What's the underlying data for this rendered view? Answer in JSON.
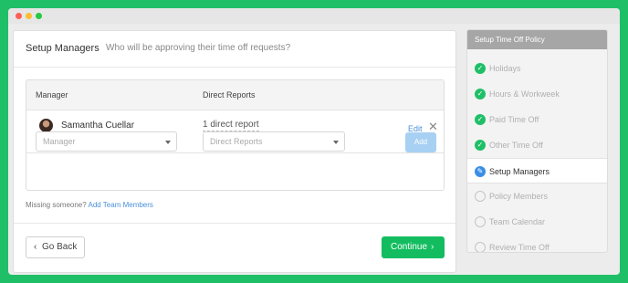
{
  "page": {
    "title": "Setup Managers",
    "subtitle": "Who will be approving their time off requests?"
  },
  "table": {
    "columns": [
      "Manager",
      "Direct Reports"
    ],
    "rows": [
      {
        "manager": "Samantha Cuellar",
        "direct_reports": "1 direct report",
        "edit_label": "Edit"
      }
    ],
    "new_row": {
      "manager_placeholder": "Manager",
      "reports_placeholder": "Direct Reports",
      "add_label": "Add"
    }
  },
  "missing": {
    "text": "Missing someone?",
    "link": "Add Team Members"
  },
  "footer": {
    "back_label": "Go Back",
    "continue_label": "Continue"
  },
  "sidebar": {
    "title": "Setup Time Off Policy",
    "steps": [
      {
        "label": "Holidays",
        "status": "done"
      },
      {
        "label": "Hours & Workweek",
        "status": "done"
      },
      {
        "label": "Paid Time Off",
        "status": "done"
      },
      {
        "label": "Other Time Off",
        "status": "done"
      },
      {
        "label": "Setup Managers",
        "status": "current"
      },
      {
        "label": "Policy Members",
        "status": "todo"
      },
      {
        "label": "Team Calendar",
        "status": "todo"
      },
      {
        "label": "Review Time Off",
        "status": "todo"
      }
    ]
  },
  "colors": {
    "background": "#1fbf67",
    "primary_button": "#13bd5f",
    "link": "#4a90d9",
    "current_step": "#3a8ee6"
  },
  "icons": {
    "close": "close-icon",
    "dropdown": "chevron-down-icon",
    "back": "chevron-left-icon",
    "forward": "chevron-right-icon",
    "done": "check-circle-icon",
    "current": "pencil-circle-icon",
    "todo": "empty-circle-icon"
  }
}
